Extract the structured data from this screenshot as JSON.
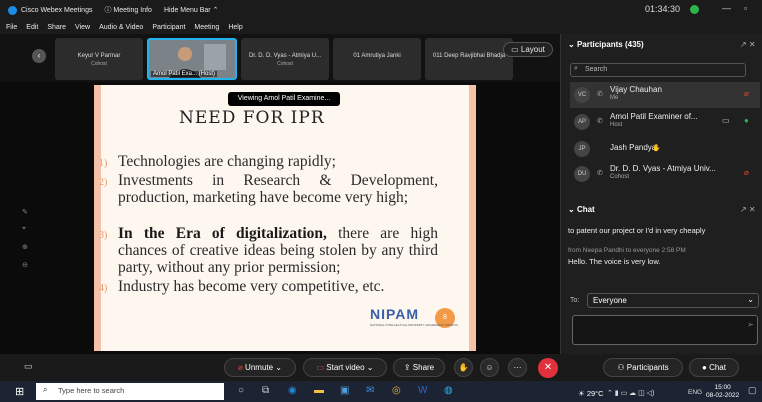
{
  "window": {
    "app_title": "Cisco Webex Meetings",
    "meeting_info": "Meeting Info",
    "hide_menu_bar": "Hide Menu Bar",
    "clock": "01:34:30"
  },
  "menu": [
    "File",
    "Edit",
    "Share",
    "View",
    "Audio & Video",
    "Participant",
    "Meeting",
    "Help"
  ],
  "filmstrip": {
    "thumbs": [
      {
        "name": "Keyur V Parmar",
        "role": "Cohost"
      },
      {
        "name": "Amol Patil Exa... (Host)",
        "role": ""
      },
      {
        "name": "Dr. D. D. Vyas - Atmiya U...",
        "role": "Cohost"
      },
      {
        "name": "01 Amrutiya Janki",
        "role": ""
      },
      {
        "name": "011 Deep Ravjibhai Bhadja",
        "role": ""
      }
    ],
    "layout_label": "Layout"
  },
  "stage": {
    "viewing_label": "Viewing Amol Patil Examine..."
  },
  "slide": {
    "title": "NEED FOR IPR",
    "points": [
      {
        "num": "1)",
        "text": "Technologies are changing rapidly;"
      },
      {
        "num": "2)",
        "text": "Investments in Research & Development, production, marketing have become very high;"
      },
      {
        "num": "3)",
        "bold": "In the Era of digitalization,",
        "text": " there are high chances of creative ideas being stolen by any third party, without any prior permission;"
      },
      {
        "num": "4)",
        "text": "Industry has become very competitive, etc."
      }
    ],
    "logo": "NIPAM",
    "logo_badge": "8",
    "logo_sub": "NATIONAL INTELLECTUAL PROPERTY AWARENESS MISSION"
  },
  "participants": {
    "header": "Participants (435)",
    "search_placeholder": "Search",
    "list": [
      {
        "initials": "VC",
        "name": "Vijay Chauhan",
        "role": "Me",
        "mic": "muted"
      },
      {
        "initials": "AP",
        "name": "Amol Patil Examiner of...",
        "role": "Host",
        "mic": "on"
      },
      {
        "initials": "JP",
        "name": "Jash Pandya",
        "role": "",
        "mic": "none"
      },
      {
        "initials": "DU",
        "name": "Dr. D. D. Vyas - Atmiya Univ...",
        "role": "Cohost",
        "mic": "muted"
      }
    ]
  },
  "chat": {
    "header": "Chat",
    "msg1": "to patent our project or I'd in very cheaply",
    "msg2_meta": "from Neepa Pandhi to everyone   2:58 PM",
    "msg2": "Hello. The voice is very low.",
    "to_label": "To:",
    "to_value": "Everyone"
  },
  "toolbar": {
    "unmute": "Unmute",
    "start_video": "Start video",
    "share": "Share",
    "participants": "Participants",
    "chat": "Chat"
  },
  "taskbar": {
    "search_placeholder": "Type here to search",
    "weather": "29°C",
    "lang": "ENG",
    "time": "15:00",
    "date": "08-02-2022"
  },
  "colors": {
    "accent": "#25b3f0",
    "leave": "#e2313a",
    "slide_band": "#f5c1a8",
    "nipam_blue": "#3a5fa8"
  }
}
